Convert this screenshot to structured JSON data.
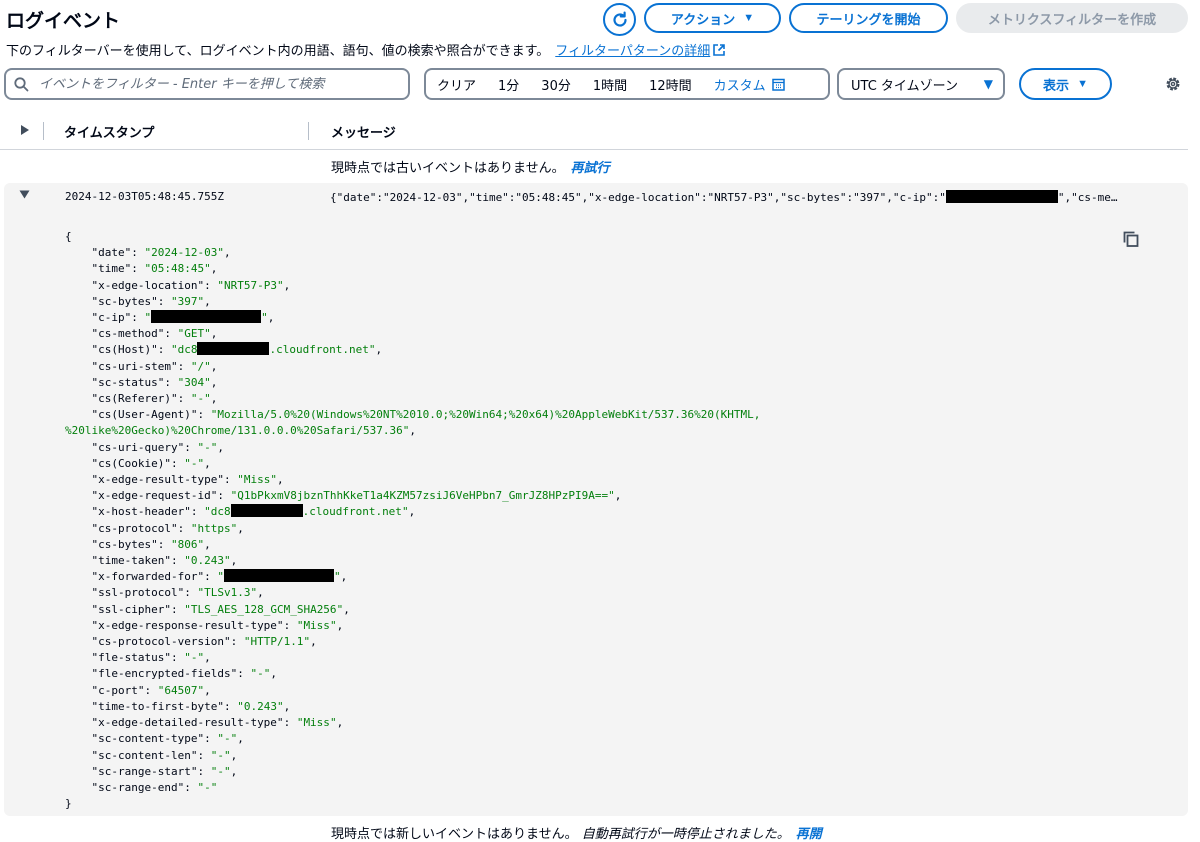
{
  "header": {
    "title": "ログイベント",
    "actions_label": "アクション",
    "tailing_label": "テーリングを開始",
    "metric_filter_label": "メトリクスフィルターを作成"
  },
  "description": {
    "text": "下のフィルターバーを使用して、ログイベント内の用語、語句、値の検索や照合ができます。",
    "link": "フィルターパターンの詳細"
  },
  "filter": {
    "placeholder": "イベントをフィルター - Enter キーを押して検索",
    "ranges": [
      "クリア",
      "1分",
      "30分",
      "1時間",
      "12時間"
    ],
    "custom_label": "カスタム",
    "timezone": "UTC タイムゾーン",
    "display_label": "表示"
  },
  "table": {
    "col_timestamp": "タイムスタンプ",
    "col_message": "メッセージ"
  },
  "status": {
    "older_text": "現時点では古いイベントはありません。",
    "older_link": "再試行",
    "newer_text": "現時点では新しいイベントはありません。",
    "newer_paused": "自動再試行が一時停止されました。",
    "newer_link": "再開"
  },
  "event": {
    "timestamp": "2024-12-03T05:48:45.755Z",
    "summary_before": "{\"date\":\"2024-12-03\",\"time\":\"05:48:45\",\"x-edge-location\":\"NRT57-P3\",\"sc-bytes\":\"397\",\"c-ip\":\"",
    "summary_after": "\",\"cs-me…",
    "fields": [
      {
        "key": "date",
        "value": "2024-12-03"
      },
      {
        "key": "time",
        "value": "05:48:45"
      },
      {
        "key": "x-edge-location",
        "value": "NRT57-P3"
      },
      {
        "key": "sc-bytes",
        "value": "397"
      },
      {
        "key": "c-ip",
        "value": "",
        "redact_full": 110
      },
      {
        "key": "cs-method",
        "value": "GET"
      },
      {
        "key": "cs(Host)",
        "prefix": "dc8",
        "redact": 72,
        "value": ".cloudfront.net"
      },
      {
        "key": "cs-uri-stem",
        "value": "/"
      },
      {
        "key": "sc-status",
        "value": "304"
      },
      {
        "key": "cs(Referer)",
        "value": "-"
      },
      {
        "key": "cs(User-Agent)",
        "value": "Mozilla/5.0%20(Windows%20NT%2010.0;%20Win64;%20x64)%20AppleWebKit/537.36%20(KHTML,\n%20like%20Gecko)%20Chrome/131.0.0.0%20Safari/537.36"
      },
      {
        "key": "cs-uri-query",
        "value": "-"
      },
      {
        "key": "cs(Cookie)",
        "value": "-"
      },
      {
        "key": "x-edge-result-type",
        "value": "Miss"
      },
      {
        "key": "x-edge-request-id",
        "value": "Q1bPkxmV8jbznThhKkeT1a4KZM57zsiJ6VeHPbn7_GmrJZ8HPzPI9A=="
      },
      {
        "key": "x-host-header",
        "prefix": "dc8",
        "redact": 72,
        "value": ".cloudfront.net"
      },
      {
        "key": "cs-protocol",
        "value": "https"
      },
      {
        "key": "cs-bytes",
        "value": "806"
      },
      {
        "key": "time-taken",
        "value": "0.243"
      },
      {
        "key": "x-forwarded-for",
        "value": "",
        "redact_full": 110
      },
      {
        "key": "ssl-protocol",
        "value": "TLSv1.3"
      },
      {
        "key": "ssl-cipher",
        "value": "TLS_AES_128_GCM_SHA256"
      },
      {
        "key": "x-edge-response-result-type",
        "value": "Miss"
      },
      {
        "key": "cs-protocol-version",
        "value": "HTTP/1.1"
      },
      {
        "key": "fle-status",
        "value": "-"
      },
      {
        "key": "fle-encrypted-fields",
        "value": "-"
      },
      {
        "key": "c-port",
        "value": "64507"
      },
      {
        "key": "time-to-first-byte",
        "value": "0.243"
      },
      {
        "key": "x-edge-detailed-result-type",
        "value": "Miss"
      },
      {
        "key": "sc-content-type",
        "value": "-"
      },
      {
        "key": "sc-content-len",
        "value": "-"
      },
      {
        "key": "sc-range-start",
        "value": "-"
      },
      {
        "key": "sc-range-end",
        "value": "-"
      }
    ]
  },
  "colors": {
    "accent": "#0972d3",
    "json_string": "#037f0c",
    "row_bg": "#f4f4f4"
  }
}
